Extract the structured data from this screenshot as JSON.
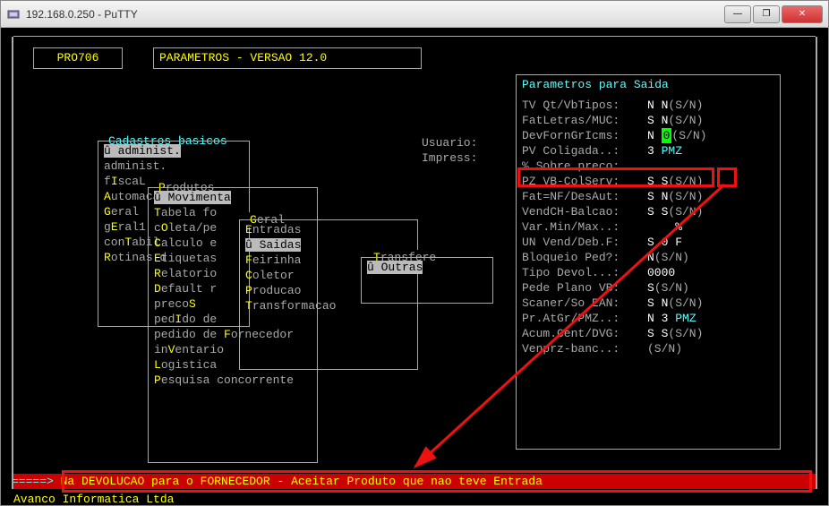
{
  "titlebar": {
    "title": "192.168.0.250 - PuTTY"
  },
  "header": {
    "code": "PRO706",
    "title": "PARAMETROS - VERSAO 12.0"
  },
  "labels": {
    "usuario": "Usuario:",
    "impress": "Impress:"
  },
  "panel_title": "Parametros para Saida",
  "menus": {
    "m1_title": "Cadastros basicos",
    "m1": [
      "û administ.",
      "administ.",
      "fIscaL",
      "Automacao",
      "Geral",
      "gEral1",
      "conTabil",
      "Rotinas d"
    ],
    "m1_hot": [
      "",
      "",
      "I",
      "A",
      "G",
      "E",
      "T",
      "R"
    ],
    "m2_title": "Produtos",
    "m2": [
      "û Movimenta",
      "Tabela fo",
      "cOleta/pe",
      "Calculo e",
      "Etiquetas",
      "Relatorio",
      "Default r",
      "precoS",
      "pedIdo de",
      "pedido de Fornecedor",
      "inVentario",
      "Logistica",
      "Pesquisa concorrente"
    ],
    "m2_hot": [
      "",
      "T",
      "O",
      "C",
      "E",
      "R",
      "D",
      "S",
      "I",
      "F",
      "V",
      "L",
      "P"
    ],
    "m3_title": "Geral",
    "m3": [
      "Entradas",
      "û Saidas",
      "Feirinha",
      "Coletor",
      "Producao",
      "Transformacao"
    ],
    "m3_hot": [
      "E",
      "",
      "F",
      "C",
      "P",
      "T"
    ],
    "m4_title": "Transfere",
    "m4": [
      "û Outras"
    ]
  },
  "params": [
    {
      "label": "TV Qt/VbTipos:",
      "val": "N N",
      "sn": "(S/N)"
    },
    {
      "label": "FatLetras/MUC:",
      "val": "S N",
      "sn": "(S/N)"
    },
    {
      "label": "DevFornGrIcms:",
      "val": "N 0",
      "sn": "(S/N)",
      "hl": true
    },
    {
      "label": "PV Coligada..:",
      "val": "3 PMZ",
      "sn": "",
      "cyan": true
    },
    {
      "label": "% Sobre preco:",
      "val": "",
      "sn": ""
    },
    {
      "label": "PZ VB-ColServ:",
      "val": "S S",
      "sn": "(S/N)"
    },
    {
      "label": "Fat=NF/DesAut:",
      "val": "S N",
      "sn": "(S/N)"
    },
    {
      "label": "VendCH-Balcao:",
      "val": "S S",
      "sn": "(S/N)"
    },
    {
      "label": "Var.Min/Max..:",
      "val": "    %",
      "sn": ""
    },
    {
      "label": "UN Vend/Deb.F:",
      "val": "S 0 F",
      "sn": ""
    },
    {
      "label": "Bloqueio Ped?:",
      "val": "N",
      "sn": "(S/N)"
    },
    {
      "label": "Tipo Devol...:",
      "val": "0000",
      "sn": ""
    },
    {
      "label": "Pede Plano VB:",
      "val": "S",
      "sn": "(S/N)"
    },
    {
      "label": "Scaner/So EAN:",
      "val": "S N",
      "sn": "(S/N)"
    },
    {
      "label": "Pr.AtGr/PMZ..:",
      "val": "N 3 PMZ",
      "sn": "",
      "cyan": true
    },
    {
      "label": "Acum.Cent/DVG:",
      "val": "S S",
      "sn": "(S/N)"
    },
    {
      "label": "Venprz-banc..:",
      "val": "",
      "sn": "(S/N)"
    }
  ],
  "status": {
    "arrows": "=====>",
    "text": "Na DEVOLUCAO para o FORNECEDOR - Aceitar Produto que nao teve Entrada"
  },
  "company": "Avanco Informatica Ltda"
}
